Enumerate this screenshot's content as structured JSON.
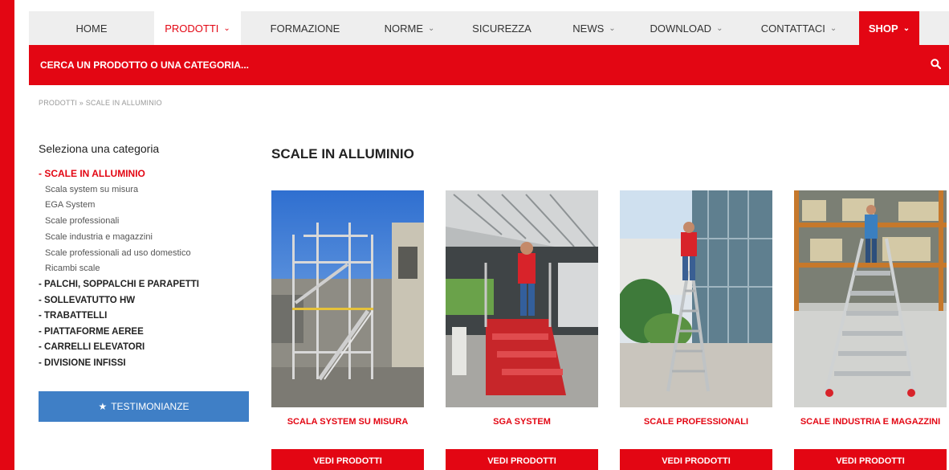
{
  "nav": {
    "items": [
      {
        "label": "HOME",
        "dropdown": false
      },
      {
        "label": "PRODOTTI",
        "dropdown": true
      },
      {
        "label": "FORMAZIONE",
        "dropdown": false
      },
      {
        "label": "NORME",
        "dropdown": true
      },
      {
        "label": "SICUREZZA",
        "dropdown": false
      },
      {
        "label": "NEWS",
        "dropdown": true
      },
      {
        "label": "DOWNLOAD",
        "dropdown": true
      },
      {
        "label": "CONTATTACI",
        "dropdown": true
      },
      {
        "label": "SHOP",
        "dropdown": true
      }
    ],
    "active_index": 1,
    "chevron_icon": "chevron-down-icon"
  },
  "search": {
    "placeholder": "CERCA UN PRODOTTO O UNA CATEGORIA...",
    "icon": "search-icon"
  },
  "breadcrumb": "PRODOTTI » SCALE IN ALLUMINIO",
  "sidebar": {
    "title": "Seleziona una categoria",
    "active_category": "- SCALE IN ALLUMINIO",
    "subcategories": [
      "Scala system su misura",
      "EGA System",
      "Scale professionali",
      "Scale industria e magazzini",
      "Scale professionali ad uso domestico",
      "Ricambi scale"
    ],
    "categories": [
      "- PALCHI, SOPPALCHI E PARAPETTI",
      "- SOLLEVATUTTO HW",
      "- TRABATTELLI",
      "- PIATTAFORME AEREE",
      "- CARRELLI ELEVATORI",
      "- DIVISIONE INFISSI"
    ],
    "testimonianze_label": "TESTIMONIANZE",
    "testimonianze_icon": "star-icon"
  },
  "main": {
    "title": "SCALE IN ALLUMINIO",
    "products": [
      {
        "name": "SCALA SYSTEM SU MISURA",
        "button": "VEDI PRODOTTI"
      },
      {
        "name": "SGA SYSTEM",
        "button": "VEDI PRODOTTI"
      },
      {
        "name": "SCALE PROFESSIONALI",
        "button": "VEDI PRODOTTI"
      },
      {
        "name": "SCALE INDUSTRIA E MAGAZZINI",
        "button": "VEDI PRODOTTI"
      }
    ]
  },
  "colors": {
    "brand_red": "#e30613",
    "button_blue": "#3f7fc6",
    "nav_background": "#eeeeee"
  }
}
